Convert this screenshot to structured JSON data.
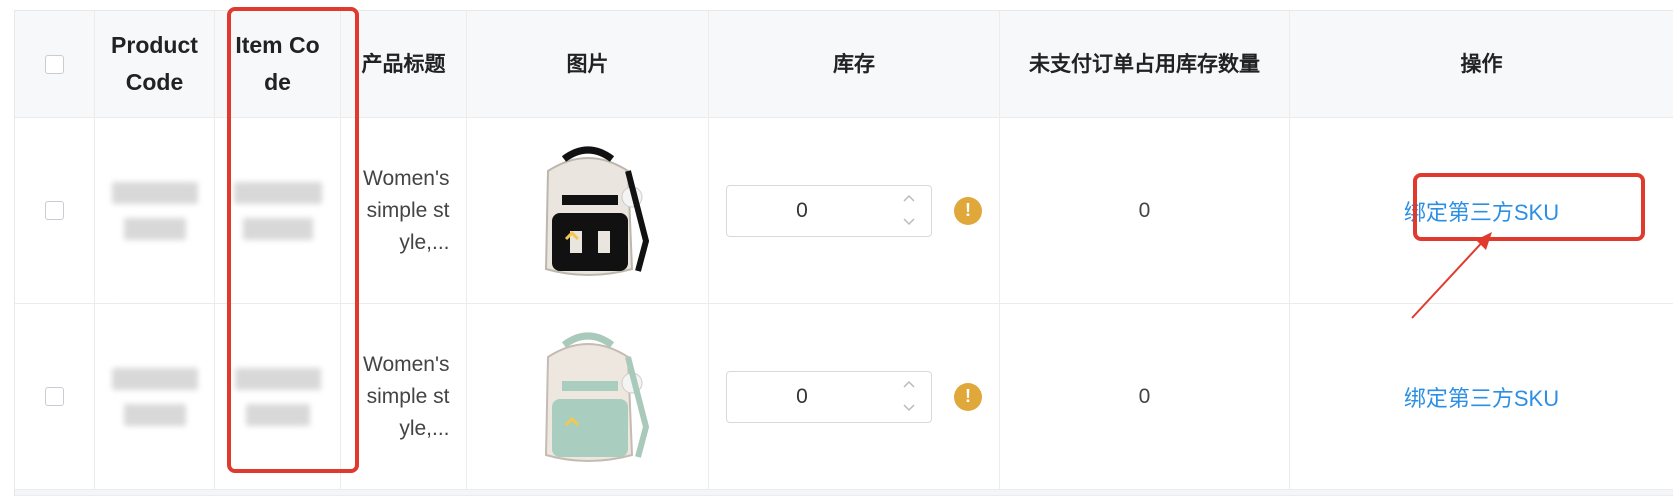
{
  "table": {
    "headers": {
      "checkbox": "",
      "product_code": "Product Code",
      "item_code": "Item Code",
      "title": "产品标题",
      "image": "图片",
      "stock": "库存",
      "unpaid": "未支付订单占用库存数量",
      "actions": "操作"
    },
    "rows": [
      {
        "title": "Women's simple style,...",
        "image_icon": "backpack-black-white-image",
        "stock_value": "0",
        "unpaid_value": "0",
        "action_label": "绑定第三方SKU"
      },
      {
        "title": "Women's simple style,...",
        "image_icon": "backpack-green-white-image",
        "stock_value": "0",
        "unpaid_value": "0",
        "action_label": "绑定第三方SKU"
      }
    ]
  },
  "icons": {
    "warning": "!",
    "stepper_up": "chevron-up-icon",
    "stepper_down": "chevron-down-icon"
  },
  "colors": {
    "annotation": "#e03a2f",
    "link": "#2b8fe5",
    "warning": "#e0a73a"
  }
}
